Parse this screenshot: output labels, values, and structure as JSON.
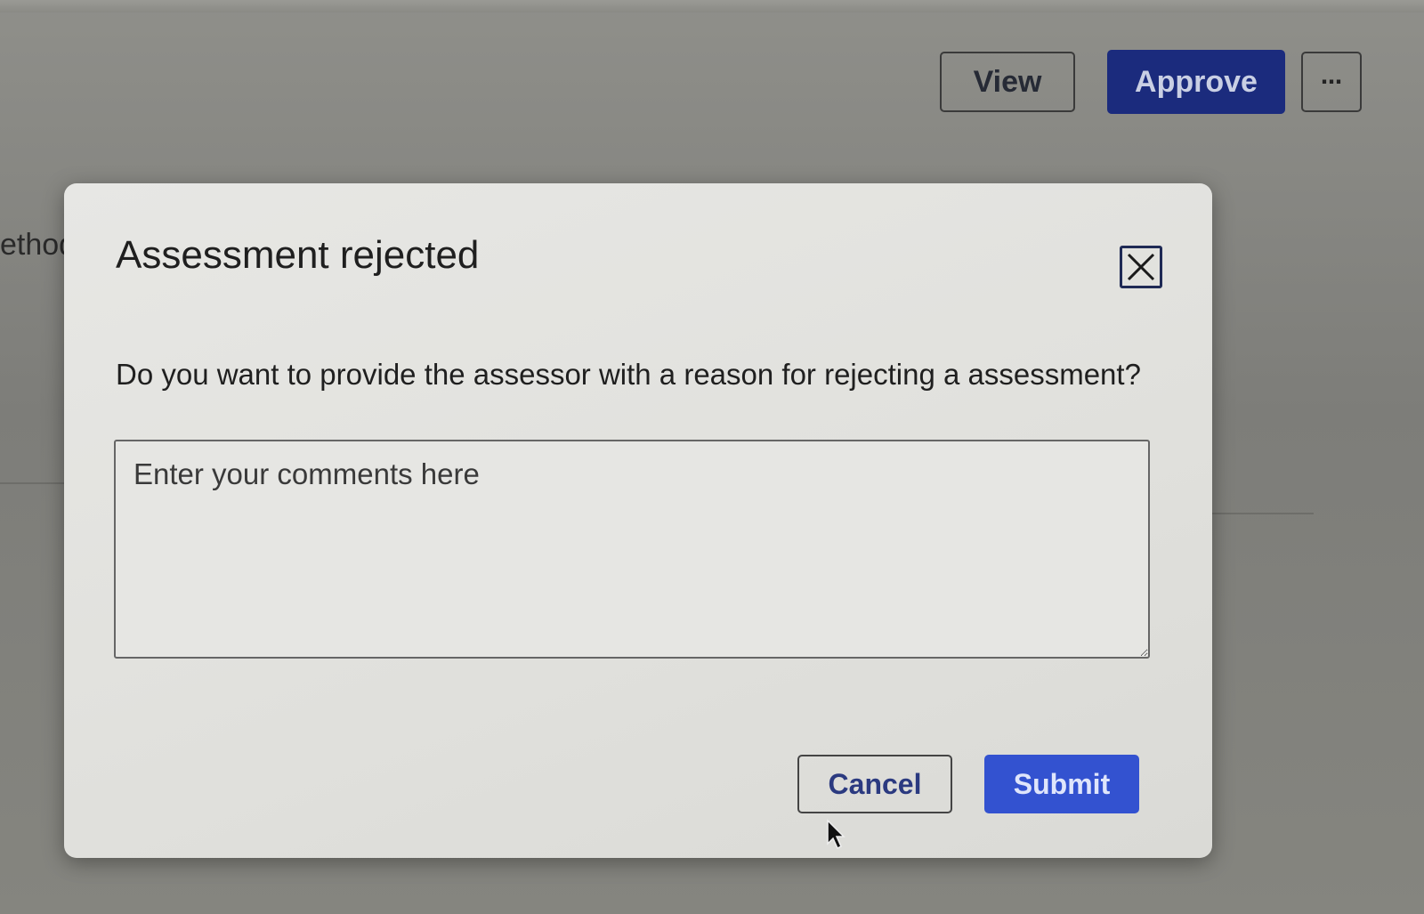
{
  "toolbar": {
    "view_label": "View",
    "approve_label": "Approve",
    "more_label": "⋯"
  },
  "background": {
    "partial_text": "ethod"
  },
  "dialog": {
    "title": "Assessment rejected",
    "question": "Do you want to provide the assessor with a reason for rejecting a assessment?",
    "comments_placeholder": "Enter your comments here",
    "comments_value": "",
    "cancel_label": "Cancel",
    "submit_label": "Submit",
    "close_icon": "close-icon"
  },
  "colors": {
    "approve_bg": "#1b2b7d",
    "submit_bg": "#3352d0",
    "cancel_text": "#2b3a80"
  }
}
